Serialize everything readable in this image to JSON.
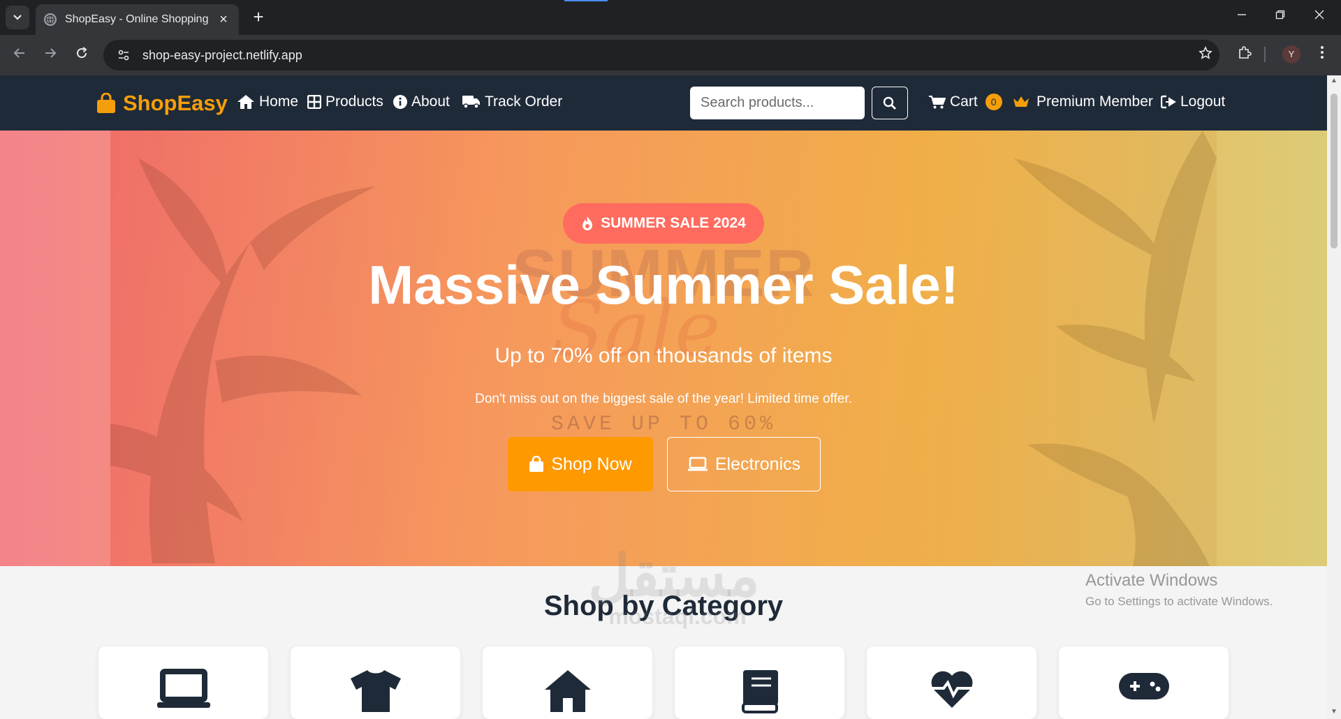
{
  "browser": {
    "tab_title": "ShopEasy - Online Shopping",
    "url": "shop-easy-project.netlify.app",
    "profile_initial": "Y"
  },
  "navbar": {
    "brand": "ShopEasy",
    "links": {
      "home": "Home",
      "products": "Products",
      "about": "About",
      "track": "Track Order"
    },
    "search_placeholder": "Search products...",
    "cart_label": "Cart",
    "cart_count": "0",
    "premium_label": "Premium Member",
    "logout_label": "Logout"
  },
  "hero": {
    "pill": "SUMMER SALE 2024",
    "ghost_summer": "SUMMER",
    "ghost_sale": "Sale",
    "ghost_save": "SAVE UP TO 60%",
    "title": "Massive Summer Sale!",
    "subtitle": "Up to 70% off on thousands of items",
    "description": "Don't miss out on the biggest sale of the year! Limited time offer.",
    "shop_now": "Shop Now",
    "electronics": "Electronics"
  },
  "categories": {
    "heading": "Shop by Category",
    "icons": [
      "laptop-icon",
      "tshirt-icon",
      "home-icon",
      "book-icon",
      "heartbeat-icon",
      "gamepad-icon"
    ]
  },
  "overlay": {
    "watermark": "مستقل",
    "watermark_domain": "mostaql.com",
    "activate_title": "Activate Windows",
    "activate_sub": "Go to Settings to activate Windows."
  },
  "colors": {
    "navbar_bg": "#1f2a38",
    "brand": "#f59e0b",
    "cta": "#ff9900",
    "pill": "#ff6b5e",
    "icon_dark": "#1f2a38"
  }
}
